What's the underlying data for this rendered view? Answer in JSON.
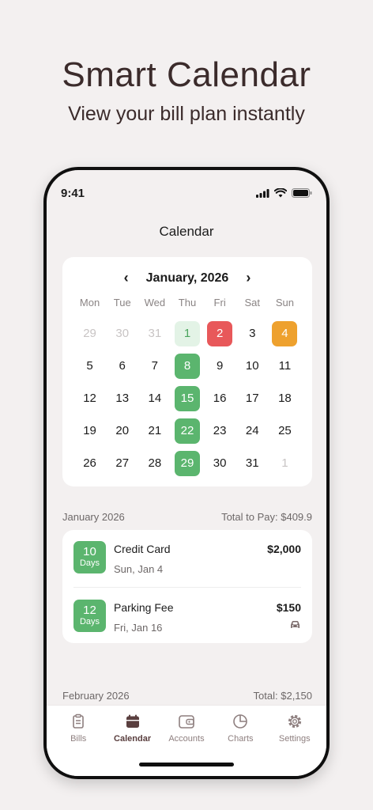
{
  "hero": {
    "title": "Smart Calendar",
    "subtitle": "View your bill plan instantly"
  },
  "status": {
    "time": "9:41"
  },
  "nav": {
    "title": "Calendar"
  },
  "calendar": {
    "month_label": "January, 2026",
    "weekdays": [
      "Mon",
      "Tue",
      "Wed",
      "Thu",
      "Fri",
      "Sat",
      "Sun"
    ],
    "days": [
      {
        "d": "29",
        "s": "muted"
      },
      {
        "d": "30",
        "s": "muted"
      },
      {
        "d": "31",
        "s": "muted"
      },
      {
        "d": "1",
        "s": "lg"
      },
      {
        "d": "2",
        "s": "r"
      },
      {
        "d": "3",
        "s": ""
      },
      {
        "d": "4",
        "s": "o"
      },
      {
        "d": "5",
        "s": ""
      },
      {
        "d": "6",
        "s": ""
      },
      {
        "d": "7",
        "s": ""
      },
      {
        "d": "8",
        "s": "g"
      },
      {
        "d": "9",
        "s": ""
      },
      {
        "d": "10",
        "s": ""
      },
      {
        "d": "11",
        "s": ""
      },
      {
        "d": "12",
        "s": ""
      },
      {
        "d": "13",
        "s": ""
      },
      {
        "d": "14",
        "s": ""
      },
      {
        "d": "15",
        "s": "g"
      },
      {
        "d": "16",
        "s": ""
      },
      {
        "d": "17",
        "s": ""
      },
      {
        "d": "18",
        "s": ""
      },
      {
        "d": "19",
        "s": ""
      },
      {
        "d": "20",
        "s": ""
      },
      {
        "d": "21",
        "s": ""
      },
      {
        "d": "22",
        "s": "g"
      },
      {
        "d": "23",
        "s": ""
      },
      {
        "d": "24",
        "s": ""
      },
      {
        "d": "25",
        "s": ""
      },
      {
        "d": "26",
        "s": ""
      },
      {
        "d": "27",
        "s": ""
      },
      {
        "d": "28",
        "s": ""
      },
      {
        "d": "29",
        "s": "g"
      },
      {
        "d": "30",
        "s": ""
      },
      {
        "d": "31",
        "s": ""
      },
      {
        "d": "1",
        "s": "muted"
      }
    ]
  },
  "section_jan": {
    "label": "January 2026",
    "total": "Total to Pay: $409.9"
  },
  "bills": [
    {
      "days_num": "10",
      "days_label": "Days",
      "name": "Credit Card",
      "date": "Sun, Jan 4",
      "amount": "$2,000"
    },
    {
      "days_num": "12",
      "days_label": "Days",
      "name": "Parking Fee",
      "date": "Fri, Jan 16",
      "amount": "$150",
      "icon": "car-icon"
    }
  ],
  "section_feb": {
    "label": "February 2026",
    "total": "Total: $2,150"
  },
  "tabs": [
    {
      "label": "Bills",
      "icon": "clipboard-icon"
    },
    {
      "label": "Calendar",
      "icon": "calendar-icon"
    },
    {
      "label": "Accounts",
      "icon": "wallet-icon"
    },
    {
      "label": "Charts",
      "icon": "pie-chart-icon"
    },
    {
      "label": "Settings",
      "icon": "gear-icon"
    }
  ],
  "colors": {
    "green": "#5bb56e",
    "red": "#e8585a",
    "orange": "#eea12e",
    "light_green": "#e3f3e6"
  }
}
